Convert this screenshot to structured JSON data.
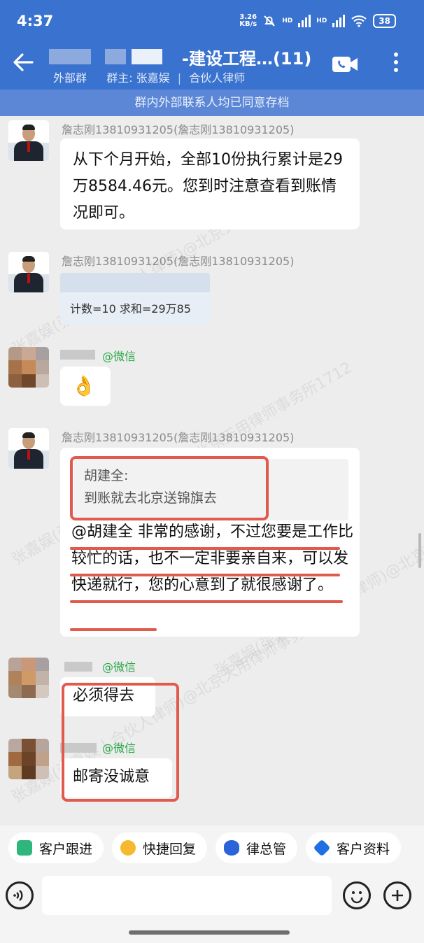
{
  "status_bar": {
    "time": "4:37",
    "net_speed_value": "3.26",
    "net_speed_unit": "KB/s",
    "hd1": "HD",
    "hd2": "HD",
    "battery": "38"
  },
  "header": {
    "title": "-建设工程…(11)",
    "group_type": "外部群",
    "owner": "群主: 张嘉娱",
    "owner_role": "合伙人律师",
    "separator": "|",
    "notice": "群内外部联系人均已同意存档"
  },
  "messages": {
    "m1": {
      "sender": "詹志刚13810931205(詹志刚13810931205)",
      "text": "从下个月开始，全部10份执行累计是29万8584.46元。您到时注意查看到账情况即可。"
    },
    "m2": {
      "sender": "詹志刚13810931205(詹志刚13810931205)",
      "image_text": "计数=10    求和=29万85"
    },
    "m3": {
      "sender_tag": "@微信",
      "emoji": "👌"
    },
    "m4": {
      "sender": "詹志刚13810931205(詹志刚13810931205)",
      "quote_author": "胡建全:",
      "quote_text": "到账就去北京送锦旗去",
      "text": "@胡建全  非常的感谢，不过您要是工作比较忙的话，也不一定非要亲自来，可以发快递就行，您的心意到了就很感谢了。"
    },
    "m5": {
      "sender_tag": "@微信",
      "text": "必须得去"
    },
    "m6": {
      "sender_tag": "@微信",
      "text": "邮寄没诚意"
    }
  },
  "watermark": {
    "line1": "张嘉娱(张嘉娱 | 合伙人律师)@北京天用律师事务所1712"
  },
  "shortcuts": [
    {
      "label": "客户跟进",
      "icon": "customer-follow-icon",
      "color": "#2fb67c"
    },
    {
      "label": "快捷回复",
      "icon": "quick-reply-icon",
      "color": "#f5b82e"
    },
    {
      "label": "律总管",
      "icon": "lawyer-manager-icon",
      "color": "#2b63d9"
    },
    {
      "label": "客户资料",
      "icon": "customer-info-icon",
      "color": "#1f6fe5"
    }
  ],
  "colors": {
    "header_bg": "#3a72cf",
    "notice_bg": "#5b87d6",
    "chat_bg": "#ededed",
    "annotation_red": "#e05a4e",
    "wechat_green": "#2aa84a"
  }
}
